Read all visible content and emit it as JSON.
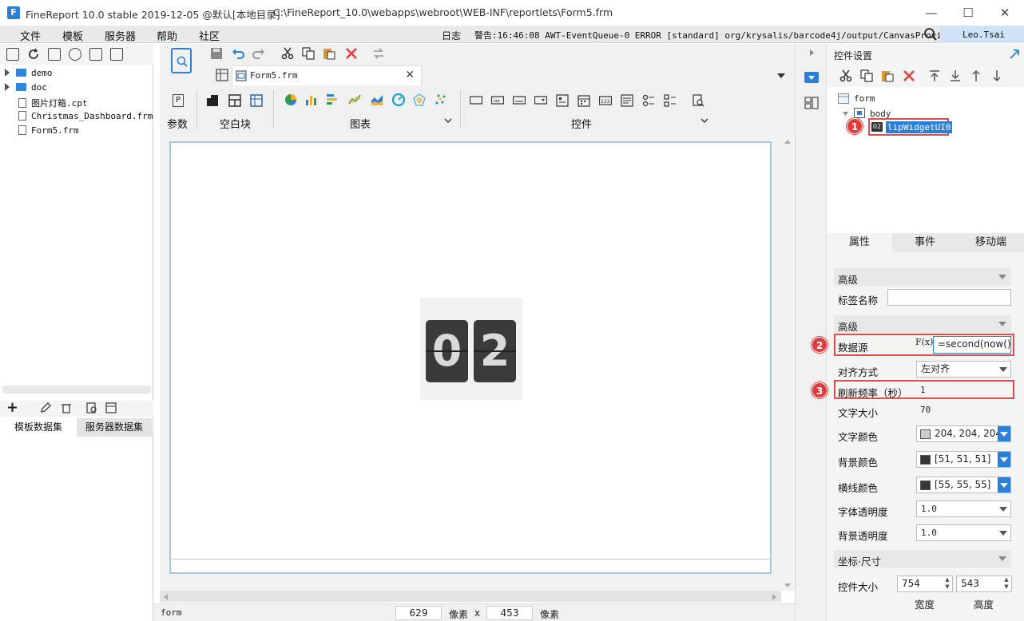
{
  "window": {
    "title": "FineReport 10.0 stable 2019-12-05 @默认[本地目录]",
    "path": "C:\\FineReport_10.0\\webapps\\webroot\\WEB-INF\\reportlets\\Form5.frm",
    "minimize": "—",
    "maximize": "☐",
    "close": "✕"
  },
  "menu": {
    "items": [
      "文件",
      "模板",
      "服务器",
      "帮助",
      "社区"
    ],
    "log_label": "日志",
    "log_text": "警告:16:46:08 AWT-EventQueue-0 ERROR [standard] org/krysalis/barcode4j/output/CanvasProvider",
    "user": "Leo.Tsai"
  },
  "left_panel": {
    "tree": [
      {
        "type": "folder",
        "label": "demo"
      },
      {
        "type": "folder",
        "label": "doc"
      },
      {
        "type": "file",
        "label": "图片灯箱.cpt"
      },
      {
        "type": "file",
        "label": "Christmas_Dashboard.frm"
      },
      {
        "type": "file",
        "label": "Form5.frm"
      }
    ],
    "tabs": [
      "模板数据集",
      "服务器数据集"
    ],
    "add_label": "+"
  },
  "center": {
    "file_tab": "Form5.frm",
    "groups": [
      "参数",
      "空白块",
      "图表",
      "控件"
    ],
    "param_icon": "P"
  },
  "canvas": {
    "digits": [
      "0",
      "2"
    ]
  },
  "status": {
    "name": "form",
    "width": "629",
    "height": "453",
    "unit1": "像素",
    "sep": "x",
    "unit2": "像素"
  },
  "right_panel": {
    "title": "控件设置",
    "tree": {
      "root": "form",
      "body": "body",
      "widget": "lipWidgetUI0"
    },
    "tabs": [
      "属性",
      "事件",
      "移动端"
    ],
    "badges": [
      "1",
      "2",
      "3"
    ],
    "sections": {
      "advanced1": "高级",
      "advanced2": "高级",
      "coord": "坐标·尺寸"
    },
    "props": {
      "tag_name_label": "标签名称",
      "tag_name_value": "",
      "datasource_label": "数据源",
      "datasource_fx": "F(x)",
      "datasource_value": "=second(now())",
      "align_label": "对齐方式",
      "align_value": "左对齐",
      "refresh_label": "刷新频率（秒）",
      "refresh_value": "1",
      "fontsize_label": "文字大小",
      "fontsize_value": "70",
      "textcolor_label": "文字颜色",
      "textcolor_value": "204, 204, 204]",
      "textcolor_hex": "#cccccc",
      "bgcolor_label": "背景颜色",
      "bgcolor_value": "[51, 51, 51]",
      "bgcolor_hex": "#333333",
      "linecolor_label": "横线颜色",
      "linecolor_value": "[55, 55, 55]",
      "linecolor_hex": "#373737",
      "fontopacity_label": "字体透明度",
      "fontopacity_value": "1.0",
      "bgopacity_label": "背景透明度",
      "bgopacity_value": "1.0",
      "size_label": "控件大小",
      "size_width": "754",
      "size_height": "543",
      "width_label": "宽度",
      "height_label": "高度"
    }
  },
  "colors": {
    "accent": "#2b7fd6",
    "highlight": "#e04b4b"
  }
}
